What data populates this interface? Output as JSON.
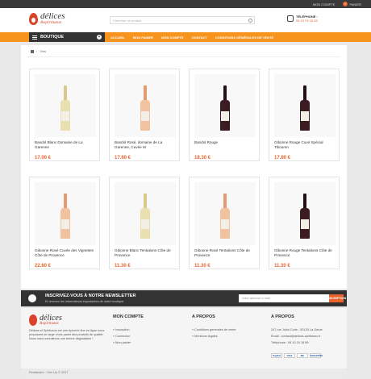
{
  "topbar": {
    "account": "MON COMPTE",
    "cart_count": "0",
    "cart_label": "PANIER"
  },
  "logo": {
    "line1": "délices",
    "line2": "&spiritueux"
  },
  "search": {
    "placeholder": "Chercher un produit"
  },
  "phone": {
    "label": "TÉLÉPHONE :",
    "number": "06 10 24 18 89"
  },
  "nav": {
    "boutique": "BOUTIQUE",
    "menu": [
      "ACCUEIL",
      "MON PANIER",
      "MON COMPTE",
      "CONTACT",
      "CONDITIONS GÉNÉRALES DE VENTE"
    ]
  },
  "breadcrumb": {
    "current": "Vins"
  },
  "products": [
    {
      "name": "Bandol Blanc Domaine de La Garenne",
      "price": "17.00 €",
      "wine": "white"
    },
    {
      "name": "Bandol Rosé, domaine de La Garenne, Cuvée M",
      "price": "17.60 €",
      "wine": "rose"
    },
    {
      "name": "Bandol Rouge",
      "price": "18.30 €",
      "wine": "red"
    },
    {
      "name": "Gibonne Rouge Cuvé Spécial Tibouren",
      "price": "17.80 €",
      "wine": "red"
    },
    {
      "name": "Gibonne Rosé Cuvée des Vignettes Côte de Provence",
      "price": "22.60 €",
      "wine": "rose"
    },
    {
      "name": "Gibonne Blanc Tentations Côte de Provence",
      "price": "11.30 €",
      "wine": "white"
    },
    {
      "name": "Gibonne Rosé Tentations Côte de Provence",
      "price": "11.30 €",
      "wine": "rose"
    },
    {
      "name": "Gibonne Rouge Tentations Côte de Provence",
      "price": "11.30 €",
      "wine": "red"
    }
  ],
  "newsletter": {
    "title": "INSCRIVEZ-VOUS À NOTRE NEWSLETTER",
    "subtitle": "Et recevez les informations importantes de notre boutique.",
    "placeholder": "Votre adresse e-mail",
    "button": "INSCRIPTION"
  },
  "footer": {
    "logo1": "délices",
    "logo2": "&spiritueux",
    "desc": "Délices et Spiritueux est une épicerie fine en ligne nous proposant un large choix parmi des produits de qualité. Nous nous souhaitons une bonne dégustation !",
    "col1": {
      "title": "MON COMPTE",
      "items": [
        "» Inscription",
        "» Connexion",
        "» Mon panier"
      ]
    },
    "col2": {
      "title": "A PROPOS",
      "items": [
        "» Conditions générales de vente",
        "» Mentions légales"
      ]
    },
    "col3": {
      "title": "A PROPOS",
      "items": [
        "247 rue Joliot Curie - 83130 La Garde",
        "Email : contact@delices-spiritueux.fr",
        "Téléphone : 06 10 24 18 89"
      ]
    },
    "payments": [
      "PayPal",
      "VISA",
      "MC",
      "MAESTRO"
    ]
  },
  "bottom": {
    "credit": "Réalisation : One Up © 2017"
  }
}
